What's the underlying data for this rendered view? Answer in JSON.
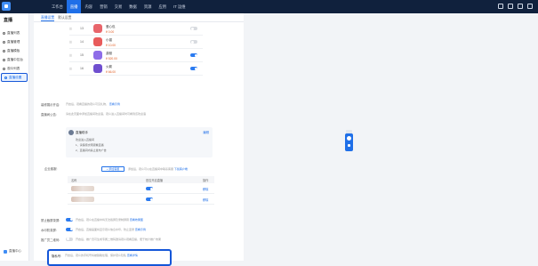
{
  "topnav": {
    "items": [
      "工作台",
      "直播",
      "内容",
      "营销",
      "交易",
      "数据",
      "资源",
      "应用",
      "IT 运维"
    ],
    "active_index": 1,
    "icons": [
      "message-icon",
      "help-icon",
      "settings-icon",
      "user-icon"
    ]
  },
  "sidebar": {
    "title": "直播",
    "items": [
      "直播列表",
      "直播管理",
      "直播模板",
      "直播中控台",
      "观众列表",
      "直播设置"
    ],
    "active_index": 5,
    "bottom_label": "直播中心"
  },
  "tabs": [
    "直播设置",
    "默认设置"
  ],
  "products": [
    {
      "idx": "13",
      "name": "爱心包",
      "price": "¥ 0.00",
      "toggle": false,
      "color": "#e8656b"
    },
    {
      "idx": "14",
      "name": "小猫",
      "price": "¥ 10.00",
      "toggle": false,
      "color": "#e85b5b"
    },
    {
      "idx": "15",
      "name": "游艇",
      "price": "¥ 520.00",
      "toggle": true,
      "color": "#8e6de8"
    },
    {
      "idx": "16",
      "name": "火箭",
      "price": "¥ 66.00",
      "toggle": true,
      "color": "#6f4fcf"
    }
  ],
  "settings": {
    "display_label": "装修展示开启:",
    "display_hint": "开启后，观看直播的观众可见礼物，",
    "display_link": "查看示例",
    "welcome_label": "直播间公告:",
    "welcome_hint": "请在此页面中添加直播间欢迎语，观众进入直播间时可看到该欢迎语",
    "card_name": "直播助手",
    "card_edit": "编辑",
    "card_lines": [
      "欢迎进入直播间",
      "1、请保持文明观看直播",
      "2、直播间内禁止发布广告"
    ],
    "service_label": "企业客服:",
    "add_button": "+ 添加客服",
    "service_hint": "添加后，观众可以在直播间中联系客服",
    "service_link": "下载客户端",
    "table_headers": [
      "名称",
      "是否开启直播",
      "操作"
    ],
    "table_rows": [
      {
        "toggle": true,
        "action": "移除"
      },
      {
        "toggle": true,
        "action": "移除"
      }
    ],
    "toggle_rows": [
      {
        "label": "禁止截屏录屏:",
        "hint": "开启后，观众在直播中将无法截屏及录制屏幕",
        "link": "查看效果图",
        "on": true
      },
      {
        "label": "水印防录屏:",
        "hint": "开启后，直播画面将显示观众信息水印，防止盗录",
        "link": "查看示例",
        "on": true
      },
      {
        "label": "推广员二维码:",
        "hint": "开启后，推广员可生成专属二维码邀请观众观看直播，便于统计推广效果",
        "link": "",
        "on": false
      }
    ],
    "highlight_label": "隐私号:",
    "highlight_hint": "开启后，观众的手机号将被脱敏处理，保护观众隐私",
    "highlight_link": "查看详情"
  }
}
